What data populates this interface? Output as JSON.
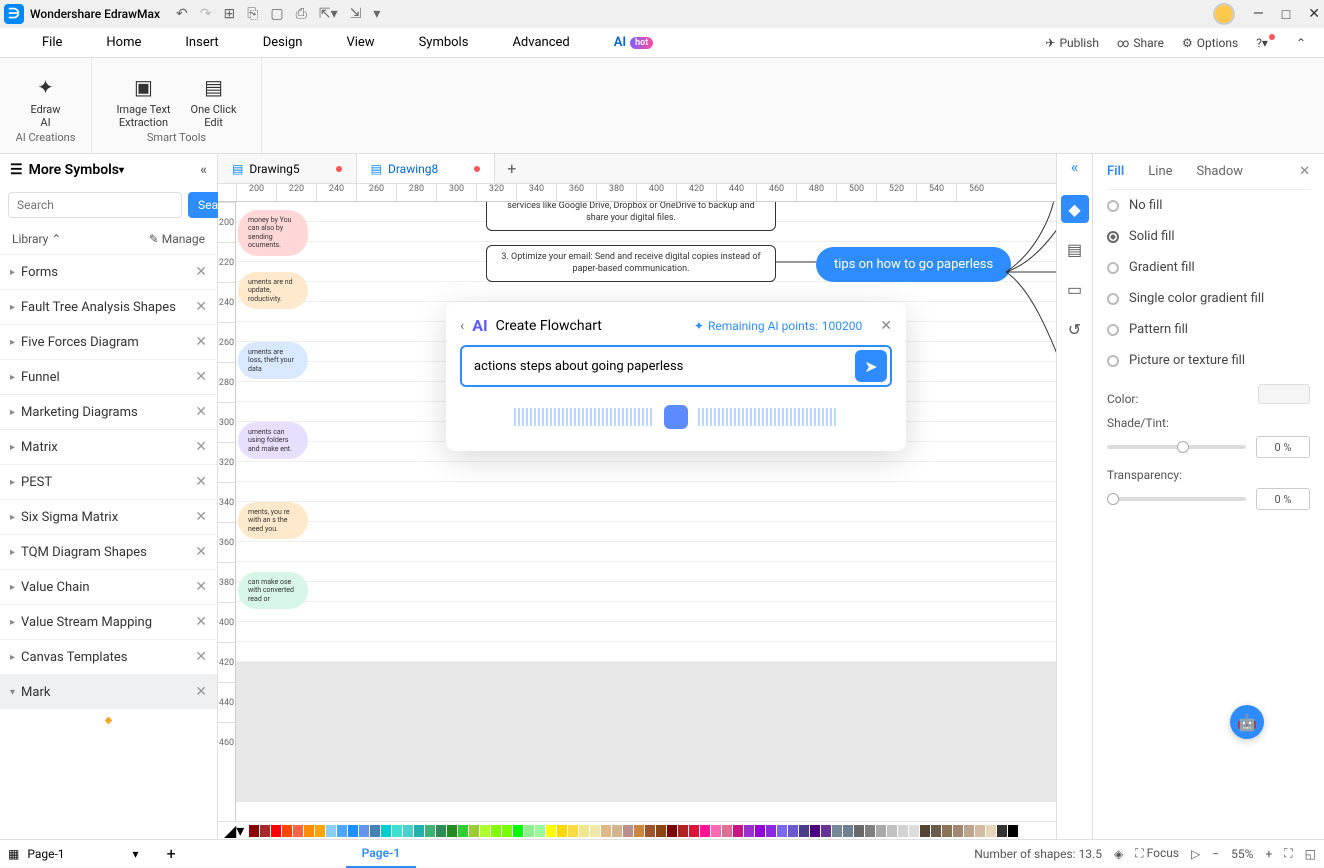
{
  "app": {
    "title": "Wondershare EdrawMax"
  },
  "menu": {
    "items": [
      "File",
      "Home",
      "Insert",
      "Design",
      "View",
      "Symbols",
      "Advanced"
    ],
    "ai": "AI",
    "hot": "hot",
    "right": {
      "publish": "Publish",
      "share": "Share",
      "options": "Options"
    }
  },
  "ribbon": {
    "edraw_ai": "Edraw\nAI",
    "image_text": "Image Text\nExtraction",
    "one_click": "One Click\nEdit",
    "g1": "AI Creations",
    "g2": "Smart Tools"
  },
  "sidebar": {
    "more": "More Symbols",
    "search_ph": "Search",
    "search_btn": "Search",
    "library": "Library",
    "manage": "Manage",
    "items": [
      {
        "label": "Forms"
      },
      {
        "label": "Fault Tree Analysis Shapes"
      },
      {
        "label": "Five Forces Diagram"
      },
      {
        "label": "Funnel"
      },
      {
        "label": "Marketing Diagrams"
      },
      {
        "label": "Matrix"
      },
      {
        "label": "PEST"
      },
      {
        "label": "Six Sigma Matrix"
      },
      {
        "label": "TQM Diagram Shapes"
      },
      {
        "label": "Value Chain"
      },
      {
        "label": "Value Stream Mapping"
      },
      {
        "label": "Canvas Templates"
      },
      {
        "label": "Mark"
      }
    ]
  },
  "tabs": {
    "t1": "Drawing5",
    "t2": "Drawing8"
  },
  "ruler_h": [
    "200",
    "220",
    "240",
    "260",
    "280",
    "300",
    "320",
    "340",
    "360",
    "380",
    "400",
    "420",
    "440",
    "460",
    "480",
    "500",
    "520",
    "540",
    "560"
  ],
  "ruler_v": [
    "200",
    "220",
    "240",
    "260",
    "280",
    "300",
    "320",
    "340",
    "360",
    "380",
    "400",
    "420",
    "440",
    "460"
  ],
  "canvas": {
    "box2": "3. Optimize your email: Send and receive digital copies instead of paper-based communication.",
    "box1_partial": "services like Google Drive, Dropbox or OneDrive to backup and share your digital files.",
    "main": "tips on how to go paperless",
    "pills": [
      "money by\nYou can also\nby sending\nocuments.",
      "uments are\nnd update,\nroductivity.",
      "uments are\nloss, theft\nyour data",
      "uments can\nusing folders\nand make\nent.",
      "ments, you\nre with an\ns the need\nyou.",
      "can make\nose with\nconverted\nread or"
    ]
  },
  "ai": {
    "title": "Create Flowchart",
    "points_lbl": "Remaining AI points:",
    "points_val": "100200",
    "input": "actions steps about going paperless"
  },
  "right": {
    "tabs": {
      "fill": "Fill",
      "line": "Line",
      "shadow": "Shadow"
    },
    "opts": [
      "No fill",
      "Solid fill",
      "Gradient fill",
      "Single color gradient fill",
      "Pattern fill",
      "Picture or texture fill"
    ],
    "color": "Color:",
    "shade": "Shade/Tint:",
    "transparency": "Transparency:",
    "zero": "0 %"
  },
  "status": {
    "page_sel": "Page-1",
    "page_tab": "Page-1",
    "shapes": "Number of shapes: 13.5",
    "focus": "Focus",
    "zoom": "55%"
  },
  "palette": [
    "#8b0000",
    "#a52a2a",
    "#ff0000",
    "#ff4500",
    "#ff6347",
    "#ff8c00",
    "#ffa500",
    "#87cefa",
    "#4da6ff",
    "#1e90ff",
    "#6495ed",
    "#4682b4",
    "#00ced1",
    "#40e0d0",
    "#48d1cc",
    "#20b2aa",
    "#3cb371",
    "#2e8b57",
    "#228b22",
    "#32cd32",
    "#9acd32",
    "#adff2f",
    "#7fff00",
    "#7cfc00",
    "#00ff00",
    "#90ee90",
    "#98fb98",
    "#ffff00",
    "#ffd700",
    "#ffda44",
    "#f0e68c",
    "#eee8aa",
    "#deb887",
    "#d2b48c",
    "#bc8f8f",
    "#cd853f",
    "#a0522d",
    "#8b4513",
    "#800000",
    "#b22222",
    "#dc143c",
    "#ff1493",
    "#ff69b4",
    "#db7093",
    "#c71585",
    "#9932cc",
    "#9400d3",
    "#8a2be2",
    "#7b68ee",
    "#6a5acd",
    "#483d8b",
    "#4b0082",
    "#663399",
    "#778899",
    "#708090",
    "#696969",
    "#808080",
    "#a9a9a9",
    "#c0c0c0",
    "#d3d3d3",
    "#dcdcdc",
    "#554433",
    "#6b5b4b",
    "#8b7355",
    "#a08870",
    "#bca58c",
    "#d2bda3",
    "#e8d6ba",
    "#333333",
    "#000000",
    "#ffffff"
  ]
}
